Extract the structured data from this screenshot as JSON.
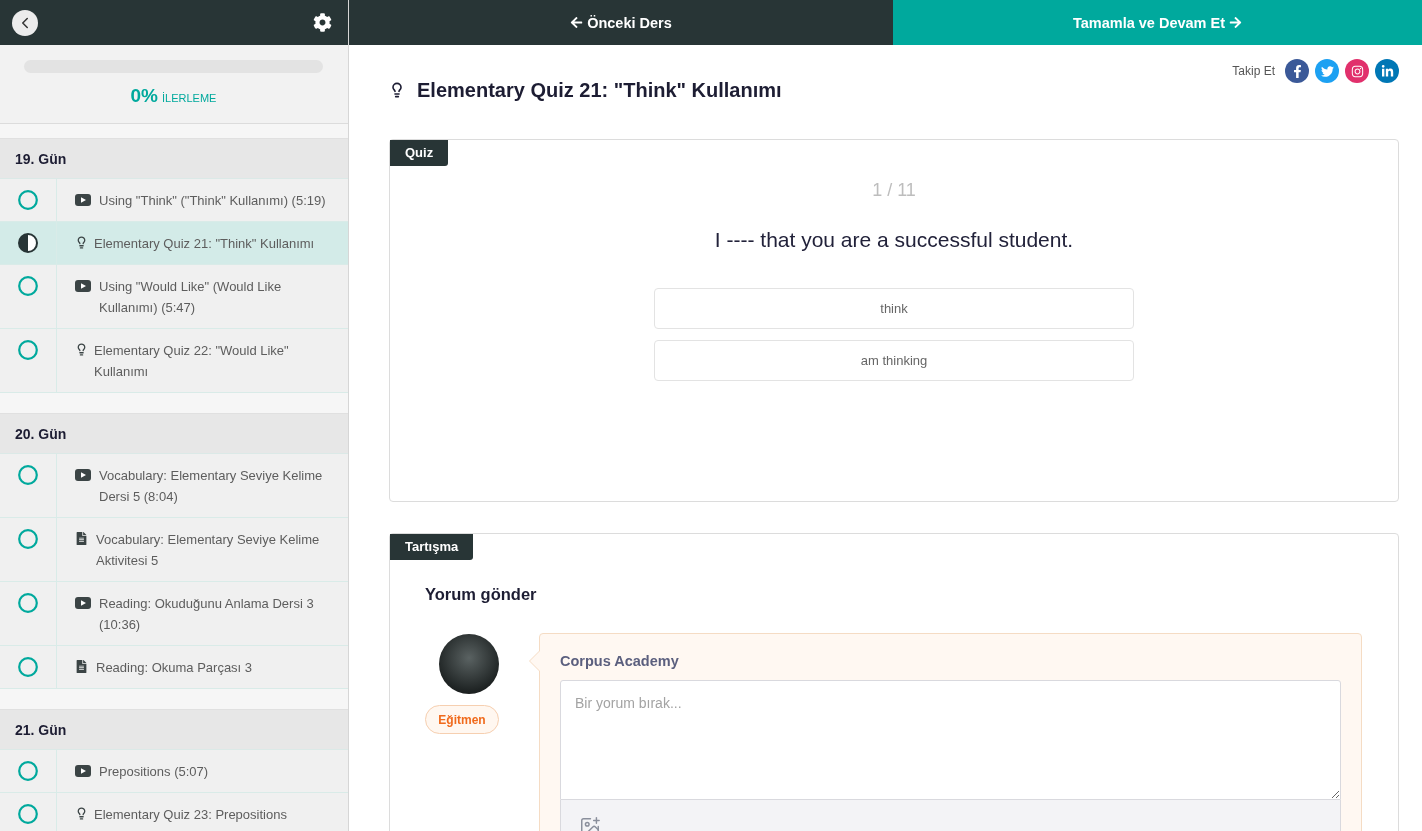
{
  "sidebar": {
    "progress": {
      "level": 0,
      "percent": "0%",
      "label": "İLERLEME"
    },
    "sections": [
      {
        "title": "19. Gün",
        "items": [
          {
            "kind": "video",
            "title": "Using \"Think\" (\"Think\" Kullanımı) (5:19)",
            "selected": false
          },
          {
            "kind": "quiz",
            "title": "Elementary Quiz 21: \"Think\" Kullanımı",
            "selected": true
          },
          {
            "kind": "video",
            "title": "Using \"Would Like\" (Would Like Kullanımı) (5:47)",
            "selected": false
          },
          {
            "kind": "quiz",
            "title": "Elementary Quiz 22: \"Would Like\" Kullanımı",
            "selected": false
          }
        ]
      },
      {
        "title": "20. Gün",
        "items": [
          {
            "kind": "video",
            "title": "Vocabulary: Elementary Seviye Kelime Dersi 5 (8:04)",
            "selected": false
          },
          {
            "kind": "document",
            "title": "Vocabulary: Elementary Seviye Kelime Aktivitesi 5",
            "selected": false
          },
          {
            "kind": "video",
            "title": "Reading: Okuduğunu Anlama Dersi 3 (10:36)",
            "selected": false
          },
          {
            "kind": "document",
            "title": "Reading: Okuma Parçası 3",
            "selected": false
          }
        ]
      },
      {
        "title": "21. Gün",
        "items": [
          {
            "kind": "video",
            "title": "Prepositions (5:07)",
            "selected": false
          },
          {
            "kind": "quiz",
            "title": "Elementary Quiz 23: Prepositions",
            "selected": false
          }
        ]
      }
    ]
  },
  "nav": {
    "previous": "Önceki Ders",
    "next": "Tamamla ve Devam Et"
  },
  "lesson": {
    "title": "Elementary Quiz 21: \"Think\" Kullanımı",
    "follow_label": "Takip Et"
  },
  "quiz": {
    "tag": "Quiz",
    "counter": "1 / 11",
    "question": "I ---- that you are a successful student.",
    "options": [
      {
        "text": "think",
        "selected": false
      },
      {
        "text": "am thinking",
        "selected": false
      }
    ]
  },
  "discussion": {
    "tag": "Tartışma",
    "heading": "Yorum gönder",
    "author": "Corpus Academy",
    "badge": "Eğitmen",
    "placeholder": "Bir yorum bırak..."
  }
}
